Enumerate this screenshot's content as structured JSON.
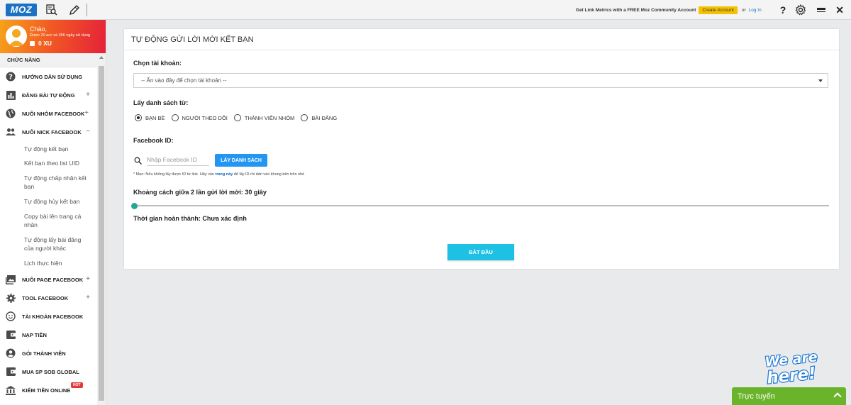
{
  "mozbar": {
    "logo": "MOZ",
    "promo": "Get Link Metrics with a FREE Moz Community Account",
    "create_label": "Create Account",
    "or_label": "or",
    "login_label": "Log In",
    "help": "?"
  },
  "user": {
    "hello": "Chào,",
    "usage": "Được 20 acc và 356 ngày sử dụng",
    "coins": "0 XU"
  },
  "sidebar": {
    "heading": "CHỨC NĂNG",
    "items": [
      {
        "label": "HƯỚNG DẪN SỬ DỤNG",
        "icon": "help-circle-icon"
      },
      {
        "label": "ĐĂNG BÀI TỰ ĐỘNG",
        "icon": "bar-chart-icon",
        "toggle": "+"
      },
      {
        "label": "NUÔI NHÓM FACEBOOK",
        "icon": "globe-icon",
        "toggle": "+"
      },
      {
        "label": "NUÔI NICK FACEBOOK",
        "icon": "people-icon",
        "toggle": "−"
      }
    ],
    "subitems": [
      "Tự động kết bạn",
      "Kết bạn theo list UID",
      "Tự động chấp nhận kết bạn",
      "Tự động hủy kết bạn",
      "Copy bài lên trang cá nhân",
      "Tự động lấy bài đăng của người khác",
      "Lịch thực hiện"
    ],
    "items2": [
      {
        "label": "NUÔI PAGE FACEBOOK",
        "icon": "photo-library-icon",
        "toggle": "+"
      },
      {
        "label": "TOOL FACEBOOK",
        "icon": "gear-icon",
        "toggle": "+"
      },
      {
        "label": "TÀI KHOẢN FACEBOOK",
        "icon": "smiley-icon"
      },
      {
        "label": "NẠP TIỀN",
        "icon": "wallet-icon"
      },
      {
        "label": "GÓI THÀNH VIÊN",
        "icon": "account-circle-icon"
      },
      {
        "label": "MUA SP SOB GLOBAL",
        "icon": "wallet-icon"
      },
      {
        "label": "KIẾM TIỀN ONLINE",
        "icon": "bank-icon",
        "badge": "HOT"
      }
    ]
  },
  "main": {
    "title": "TỰ ĐỘNG GỬI LỜI MỜI KẾT BẠN",
    "account_label": "Chọn tài khoản:",
    "account_select": "-- Ấn vào đây để chọn tài khoản --",
    "list_label": "Lấy danh sách từ:",
    "sources": [
      {
        "label": "BẠN BÈ",
        "selected": true
      },
      {
        "label": "NGƯỜI THEO DÕI",
        "selected": false
      },
      {
        "label": "THÀNH VIÊN NHÓM",
        "selected": false
      },
      {
        "label": "BÀI ĐĂNG",
        "selected": false
      }
    ],
    "fbid_label": "Facebook ID:",
    "fbid_placeholder": "Nhập Facebook ID",
    "get_list_button": "LẤY DANH SÁCH",
    "tip_prefix": "* Mẹo: Nếu không lấy được ID từ link. Hãy vào",
    "tip_link": "trang này",
    "tip_suffix": "để lấy ID rồi dán vào khung bên trên nhé",
    "interval_label": "Khoảng cách giữa 2 lần gửi lời mời: 30 giây",
    "interval_level": 0,
    "finish_label": "Thời gian hoàn thành: Chưa xác định",
    "start_button": "BẮT ĐẦU"
  },
  "widgets": {
    "we_are": "We are",
    "here": "here!",
    "chat_label": "Trực tuyến"
  },
  "colors": {
    "accent": "#2196f3",
    "start": "#1ec1e4",
    "slider": "#26a69a",
    "chat": "#6ab42b"
  }
}
